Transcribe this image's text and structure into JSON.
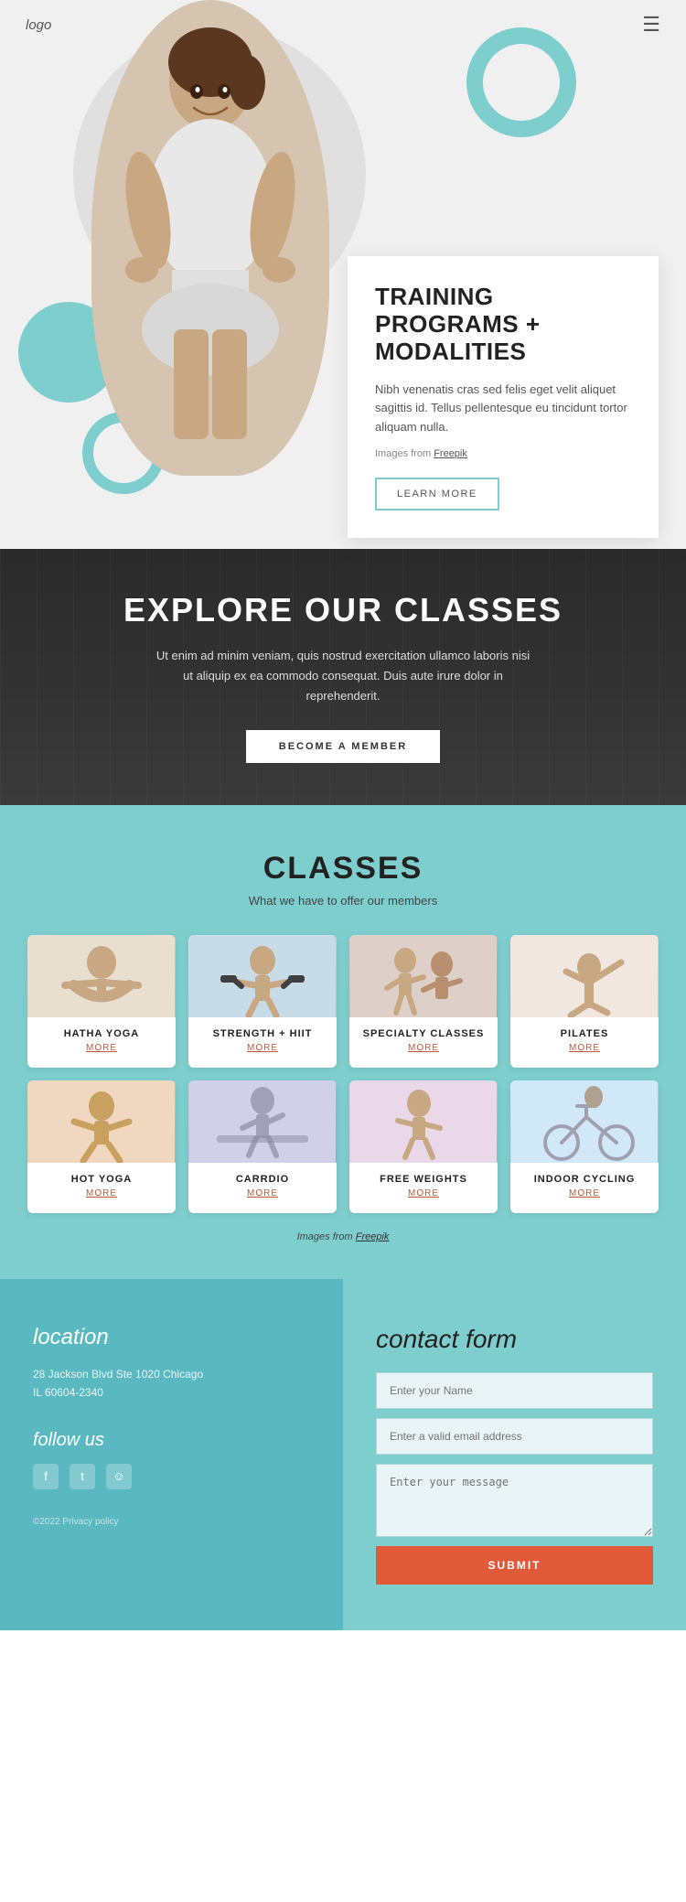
{
  "header": {
    "logo": "logo",
    "menu_icon": "☰"
  },
  "hero": {
    "title": "TRAINING PROGRAMS + MODALITIES",
    "description": "Nibh venenatis cras sed felis eget velit aliquet sagittis id. Tellus pellentesque eu tincidunt tortor aliquam nulla.",
    "images_credit_prefix": "Images from ",
    "images_credit_link": "Freepik",
    "learn_more": "LEARN MORE"
  },
  "explore": {
    "title": "EXPLORE OUR CLASSES",
    "description": "Ut enim ad minim veniam, quis nostrud exercitation ullamco laboris nisi ut aliquip ex ea commodo consequat. Duis aute irure dolor in reprehenderit.",
    "cta": "BECOME A MEMBER"
  },
  "classes": {
    "title": "CLASSES",
    "subtitle": "What we have to offer our members",
    "items": [
      {
        "name": "HATHA YOGA",
        "more": "MORE",
        "img_class": "class-img-hatha"
      },
      {
        "name": "STRENGTH + HIIT",
        "more": "MORE",
        "img_class": "class-img-strength"
      },
      {
        "name": "SPECIALTY CLASSES",
        "more": "MORE",
        "img_class": "class-img-specialty"
      },
      {
        "name": "PILATES",
        "more": "MORE",
        "img_class": "class-img-pilates"
      },
      {
        "name": "HOT YOGA",
        "more": "MORE",
        "img_class": "class-img-hotyoga"
      },
      {
        "name": "CARRDIO",
        "more": "MORE",
        "img_class": "class-img-cardio"
      },
      {
        "name": "FREE WEIGHTS",
        "more": "MORE",
        "img_class": "class-img-freeweights"
      },
      {
        "name": "INDOOR CYCLING",
        "more": "MORE",
        "img_class": "class-img-cycling"
      }
    ],
    "images_credit_prefix": "Images from ",
    "images_credit_link": "Freepik"
  },
  "location": {
    "title": "location",
    "address_line1": "28 Jackson Blvd Ste 1020 Chicago",
    "address_line2": "IL 60604-2340",
    "follow_title": "follow us",
    "social": [
      "f",
      "t",
      "☺"
    ],
    "privacy": "©2022 Privacy policy"
  },
  "contact": {
    "title": "contact form",
    "name_placeholder": "Enter your Name",
    "email_placeholder": "Enter a valid email address",
    "message_placeholder": "Enter your message",
    "submit_label": "SUBMIT"
  }
}
